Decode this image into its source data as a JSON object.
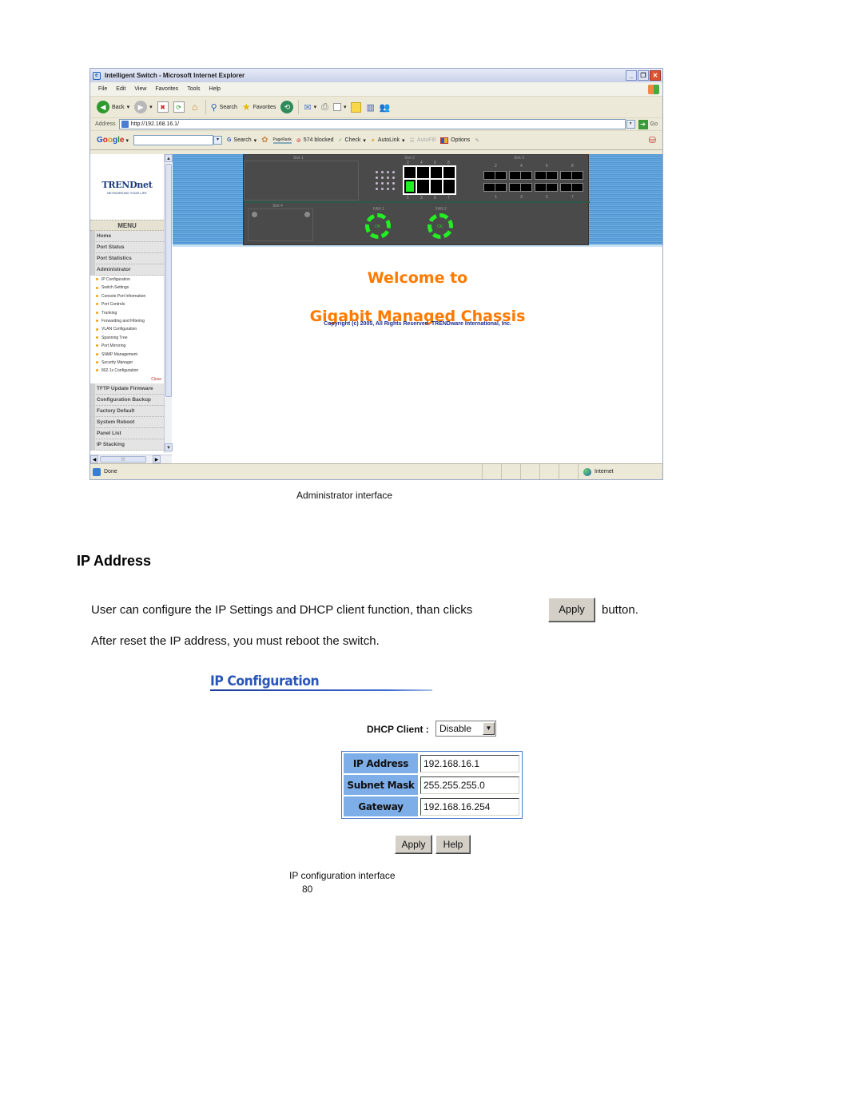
{
  "browser": {
    "title": "Intelligent Switch - Microsoft Internet Explorer",
    "window_buttons": {
      "minimize": "_",
      "restore": "❐",
      "close": "✕"
    },
    "menu": [
      "File",
      "Edit",
      "View",
      "Favorites",
      "Tools",
      "Help"
    ],
    "toolbar": {
      "back": "Back",
      "search": "Search",
      "favorites": "Favorites"
    },
    "address": {
      "label": "Address",
      "url": "http://192.168.16.1/",
      "go": "Go"
    },
    "google_bar": {
      "logo": "Google",
      "search": "Search",
      "pagerank": "PageRank",
      "blocked": "574 blocked",
      "check": "Check",
      "autolink": "AutoLink",
      "autofill": "AutoFill",
      "options": "Options"
    },
    "status": {
      "text": "Done",
      "zone": "Internet"
    }
  },
  "app": {
    "logo": "TRENDnet",
    "tagline": "NETWORKING YOUR LIFE",
    "menu_header": "MENU",
    "top_items": [
      "Home",
      "Port Status",
      "Port Statistics",
      "Administrator"
    ],
    "admin_subitems": [
      "IP Configuration",
      "Switch Settings",
      "Console Port Information",
      "Port Controls",
      "Trunking",
      "Forwarding and Filtering",
      "VLAN Configuration",
      "Spanning Tree",
      "Port Mirroring",
      "SNMP Management",
      "Security Manager",
      "802.1x Configuration"
    ],
    "close_label": "Close",
    "bottom_items": [
      "TFTP Update Firmware",
      "Configuration Backup",
      "Factory Default",
      "System Reboot",
      "Panel List",
      "IP Stacking"
    ],
    "chassis": {
      "slots": [
        "Slot 1",
        "Slot 2",
        "Slot 3",
        "Slot 4"
      ],
      "slot2_top_ports": [
        "2",
        "4",
        "6",
        "8"
      ],
      "slot2_bottom_ports": [
        "1",
        "3",
        "5",
        "7"
      ],
      "slot3_top_ports": [
        "2",
        "4",
        "6",
        "8"
      ],
      "slot3_bottom_ports": [
        "1",
        "3",
        "5",
        "7"
      ],
      "active_port": "1",
      "fans": [
        {
          "label": "FAN 1",
          "status": "OK"
        },
        {
          "label": "FAN 2",
          "status": "OK"
        }
      ],
      "status_color": "#22ee22"
    },
    "welcome_line1": "Welcome to",
    "welcome_line2": "Gigabit Managed Chassis",
    "copyright": "Copyright (c) 2005, All Rights Reserved. TRENDware International, Inc.",
    "accent_color": "#ff7a00"
  },
  "doc": {
    "caption1": "Administrator interface",
    "section_title": "IP Address",
    "para1_before": "User can configure the IP Settings and DHCP client function, than clicks",
    "para1_button": "Apply",
    "para1_after": "button.",
    "para2": "After reset the IP address, you must reboot the switch.",
    "caption2": "IP configuration interface",
    "page_number": "80"
  },
  "ip_config": {
    "title": "IP Configuration",
    "dhcp_label": "DHCP Client :",
    "dhcp_value": "Disable",
    "fields": [
      {
        "label": "IP Address",
        "value": "192.168.16.1"
      },
      {
        "label": "Subnet Mask",
        "value": "255.255.255.0"
      },
      {
        "label": "Gateway",
        "value": "192.168.16.254"
      }
    ],
    "apply_label": "Apply",
    "help_label": "Help"
  }
}
